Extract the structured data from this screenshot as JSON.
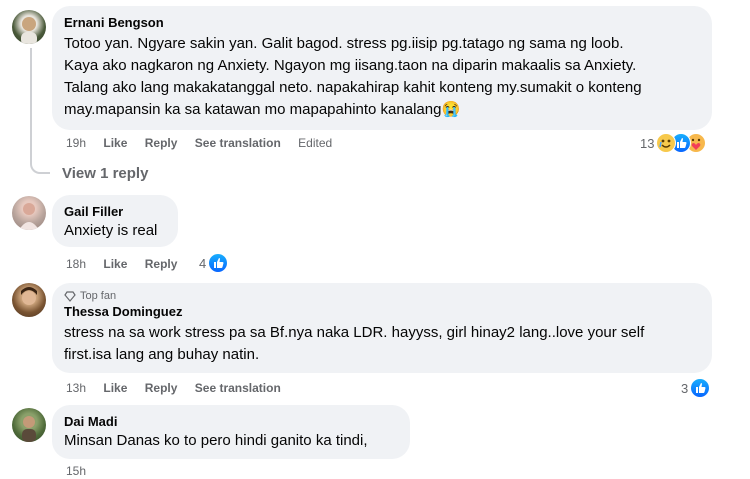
{
  "comments": [
    {
      "author": "Ernani Bengson",
      "text": "Totoo yan. Ngyare sakin yan. Galit bagod. stress pg.iisip pg.tatago ng sama ng loob.\nKaya ako nagkaron ng Anxiety. Ngayon mg iisang.taon na diparin makaalis sa Anxiety.\nTalang ako lang makakatanggal neto. napakahirap kahit konteng my.sumakit o konteng\nmay.mapansin ka sa katawan mo mapapahinto kanalang😭",
      "time": "19h",
      "like": "Like",
      "reply": "Reply",
      "translate": "See translation",
      "edited": "Edited",
      "reaction_count": "13",
      "reactions": [
        "haha",
        "like",
        "care"
      ]
    },
    {
      "author": "Gail Filler",
      "text": "Anxiety is real",
      "time": "18h",
      "like": "Like",
      "reply": "Reply",
      "reaction_count": "4",
      "reactions": [
        "like"
      ]
    },
    {
      "badge": "Top fan",
      "author": "Thessa Dominguez",
      "text": "stress na sa work stress pa sa Bf.nya naka LDR. hayyss, girl hinay2 lang..love your self\nfirst.isa lang ang buhay natin.",
      "time": "13h",
      "like": "Like",
      "reply": "Reply",
      "translate": "See translation",
      "reaction_count": "3",
      "reactions": [
        "like"
      ]
    },
    {
      "author": "Dai Madi",
      "text": "Minsan Danas ko to pero hindi ganito ka tindi,",
      "time": "15h"
    }
  ],
  "view_replies": "View 1 reply"
}
